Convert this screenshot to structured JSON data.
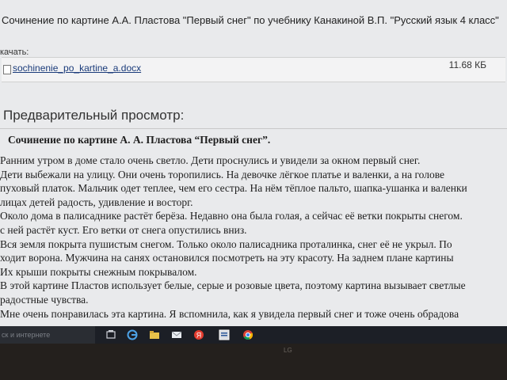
{
  "page": {
    "title": "Сочинение по картине А.А. Пластова \"Первый снег\" по учебнику Канакиной В.П. \"Русский язык 4 класс\"",
    "download_label": "качать:",
    "file": {
      "name": "sochinenie_po_kartine_a.docx",
      "size": "11.68 КБ"
    },
    "preview_title": "Предварительный просмотр:"
  },
  "document": {
    "heading": "Сочинение по картине А. А. Пластова “Первый снег”.",
    "lines": [
      "      Ранним утром в доме стало очень светло. Дети проснулись и увидели за окном первый снег.",
      "   Дети выбежали на улицу. Они очень торопились. На девочке лёгкое платье и валенки, а на голове",
      "пуховый платок. Мальчик одет теплее, чем его сестра. На нём тёплое пальто, шапка-ушанка и валенки",
      "лицах детей радость, удивление и восторг.",
      "   Около дома в палисаднике растёт берёза. Недавно она была голая, а сейчас её ветки покрыты снегом.",
      "с ней растёт куст. Его ветки от снега опустились вниз.",
      "   Вся земля покрыта пушистым снегом. Только около палисадника проталинка, снег её не укрыл. По",
      "ходит ворона. Мужчина на санях остановился посмотреть на эту красоту. На заднем плане картины",
      "Их крыши покрыты снежным покрывалом.",
      "   В этой картине Пластов использует белые, серые и розовые цвета, поэтому картина вызывает светлые",
      "радостные чувства.",
      "      Мне очень понравилась эта картина. Я вспомнила, как я увидела первый снег и тоже очень обрадова"
    ]
  },
  "taskbar": {
    "search_text": "ск и интернете",
    "icons": [
      "task-view-icon",
      "edge-icon",
      "file-explorer-icon",
      "mail-icon",
      "yandex-icon",
      "word-icon",
      "chrome-icon"
    ]
  },
  "bezel": {
    "logo": "LG"
  }
}
